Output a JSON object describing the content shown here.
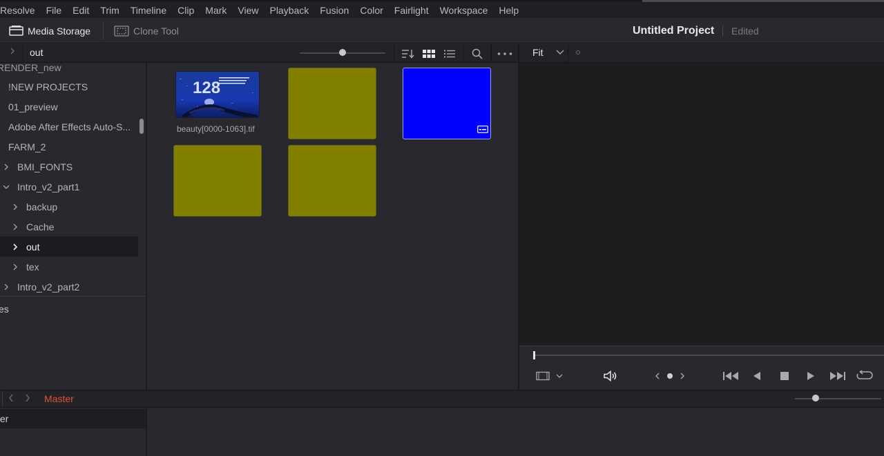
{
  "menu": {
    "items": [
      "Resolve",
      "File",
      "Edit",
      "Trim",
      "Timeline",
      "Clip",
      "Mark",
      "View",
      "Playback",
      "Fusion",
      "Color",
      "Fairlight",
      "Workspace",
      "Help"
    ]
  },
  "toolbar": {
    "media_storage": "Media Storage",
    "clone_tool": "Clone Tool",
    "project_title": "Untitled Project",
    "project_status": "Edited"
  },
  "pathbar": {
    "current": "out"
  },
  "viewer": {
    "zoom": "Fit"
  },
  "tree": {
    "items": [
      {
        "label": "RENDER_new"
      },
      {
        "label": "!NEW PROJECTS"
      },
      {
        "label": "01_preview"
      },
      {
        "label": "Adobe After Effects Auto-S..."
      },
      {
        "label": "FARM_2"
      },
      {
        "label": "BMI_FONTS"
      },
      {
        "label": "Intro_v2_part1"
      },
      {
        "label": "backup"
      },
      {
        "label": "Cache"
      },
      {
        "label": "out"
      },
      {
        "label": "tex"
      },
      {
        "label": "Intro_v2_part2"
      }
    ],
    "lower_label": "es"
  },
  "clips": {
    "thumb_name": "beauty[0000-1063].tif",
    "thumb_number": "128",
    "colors": {
      "olive": "#838000",
      "blue": "#0000ff"
    }
  },
  "bottom": {
    "bin_title": "Master",
    "left_label": "ter"
  },
  "accent": {
    "bin_title_color": "#e0503c"
  }
}
